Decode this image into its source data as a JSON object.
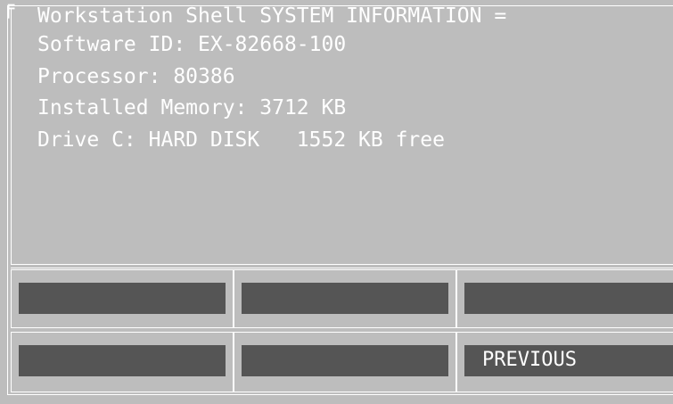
{
  "window": {
    "title": "Workstation Shell SYSTEM INFORMATION ="
  },
  "info": {
    "lines": [
      "Software ID: EX-82668-100",
      "Processor: 80386",
      "Installed Memory: 3712 KB",
      "Drive C: HARD DISK   1552 KB free"
    ]
  },
  "buttons": {
    "row1": [
      "",
      "",
      ""
    ],
    "row2": [
      "",
      "",
      "PREVIOUS"
    ]
  },
  "colors": {
    "background": "#bdbdbd",
    "button_fill": "#555555",
    "text": "#ffffff"
  }
}
